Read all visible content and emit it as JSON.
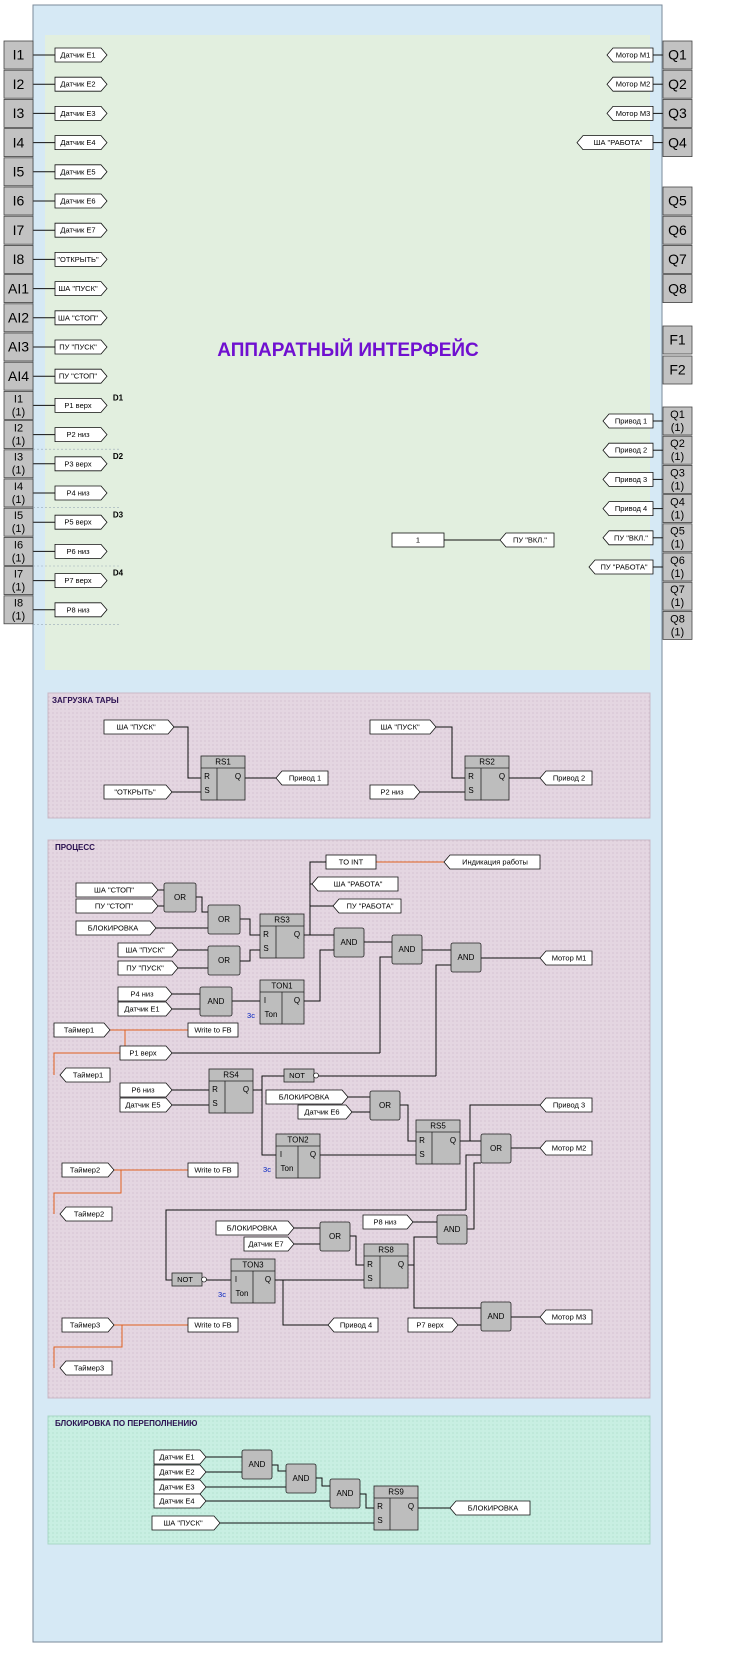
{
  "inputs_main": [
    "I1",
    "I2",
    "I3",
    "I4",
    "I5",
    "I6",
    "I7",
    "I8",
    "AI1",
    "AI2",
    "AI3",
    "AI4"
  ],
  "inputs_ext": [
    {
      "top": "I1",
      "bot": "(1)"
    },
    {
      "top": "I2",
      "bot": "(1)"
    },
    {
      "top": "I3",
      "bot": "(1)"
    },
    {
      "top": "I4",
      "bot": "(1)"
    },
    {
      "top": "I5",
      "bot": "(1)"
    },
    {
      "top": "I6",
      "bot": "(1)"
    },
    {
      "top": "I7",
      "bot": "(1)"
    },
    {
      "top": "I8",
      "bot": "(1)"
    }
  ],
  "input_tags": [
    "Датчик E1",
    "Датчик E2",
    "Датчик E3",
    "Датчик E4",
    "Датчик E5",
    "Датчик E6",
    "Датчик E7",
    "\"ОТКРЫТЬ\"",
    "ША \"ПУСК\"",
    "ША \"СТОП\"",
    "ПУ \"ПУСК\"",
    "ПУ \"СТОП\"",
    "P1 верх",
    "P2  низ",
    "P3 верх",
    "P4  низ",
    "P5 верх",
    "P6  низ",
    "P7 верх",
    "P8  низ"
  ],
  "d_labels": [
    "D1",
    "D2",
    "D3",
    "D4"
  ],
  "outputs_main": [
    "Q1",
    "Q2",
    "Q3",
    "Q4",
    "Q5",
    "Q6",
    "Q7",
    "Q8",
    "F1",
    "F2"
  ],
  "outputs_main_tags": [
    "Мотор M1",
    "Мотор M2",
    "Мотор M3",
    "ША \"РАБОТА\""
  ],
  "outputs_ext": [
    {
      "top": "Q1",
      "bot": "(1)"
    },
    {
      "top": "Q2",
      "bot": "(1)"
    },
    {
      "top": "Q3",
      "bot": "(1)"
    },
    {
      "top": "Q4",
      "bot": "(1)"
    },
    {
      "top": "Q5",
      "bot": "(1)"
    },
    {
      "top": "Q6",
      "bot": "(1)"
    },
    {
      "top": "Q7",
      "bot": "(1)"
    },
    {
      "top": "Q8",
      "bot": "(1)"
    }
  ],
  "outputs_ext_tags": [
    "Привод 1",
    "Привод 2",
    "Привод 3",
    "Привод 4",
    "ПУ \"ВКЛ.\"",
    "ПУ \"РАБОТА\""
  ],
  "hw_title": "АППАРАТНЫЙ ИНТЕРФЕЙС",
  "const_one": "1",
  "const_one_tag": "ПУ \"ВКЛ.\"",
  "sections": {
    "load": "ЗАГРУЗКА  ТАРЫ",
    "process": "ПРОЦЕСС",
    "block": "БЛОКИРОВКА   ПО    ПЕРЕПОЛНЕНИЮ"
  },
  "load": {
    "rs1": {
      "name": "RS1",
      "r": "R",
      "s": "S",
      "q": "Q"
    },
    "rs2": {
      "name": "RS2",
      "r": "R",
      "s": "S",
      "q": "Q"
    },
    "tags": [
      "ША \"ПУСК\"",
      "\"ОТКРЫТЬ\"",
      "Привод 1",
      "ША \"ПУСК\"",
      "P2  низ",
      "Привод 2"
    ]
  },
  "process": {
    "blocks": {
      "or": "OR",
      "and": "AND",
      "not": "NOT",
      "rs3": "RS3",
      "rs4": "RS4",
      "rs5": "RS5",
      "rs8": "RS8",
      "ton1": "TON1",
      "ton2": "TON2",
      "ton3": "TON3",
      "to_int": "TO INT",
      "ton_in": "Ton",
      "ton_i": "I",
      "q": "Q",
      "r": "R",
      "s": "S",
      "delay": "3с",
      "write_fb": "Write to FB"
    },
    "tags": {
      "indication": "Индикация работы",
      "sha_rabota": "ША \"РАБОТА\"",
      "pu_rabota": "ПУ \"РАБОТА\"",
      "sha_stop": "ША \"СТОП\"",
      "pu_stop": "ПУ \"СТОП\"",
      "blokirovka": "БЛОКИРОВКА",
      "sha_pusk": "ША \"ПУСК\"",
      "pu_pusk": "ПУ \"ПУСК\"",
      "p4": "P4 низ",
      "e1": "Датчик E1",
      "motor1": "Мотор M1",
      "timer1": "Таймер1",
      "p1": "P1 верх",
      "p6": "P6 низ",
      "e5": "Датчик E5",
      "e6": "Датчик E6",
      "privod3": "Привод 3",
      "motor2": "Мотор M2",
      "timer2": "Таймер2",
      "e7": "Датчик E7",
      "p8": "P8  низ",
      "privod4": "Привод 4",
      "p7": "P7 верх",
      "motor3": "Мотор M3",
      "timer3": "Таймер3"
    }
  },
  "block": {
    "tags": [
      "Датчик E1",
      "Датчик E2",
      "Датчик E3",
      "Датчик E4",
      "ША \"ПУСК\"",
      "БЛОКИРОВКА"
    ],
    "rs9": "RS9",
    "and": "AND"
  },
  "colors": {
    "frame": "#d6e9f5",
    "hw_area": "#e2efdf",
    "load_area": "#e6d9e3",
    "process_area": "#e6d9e3",
    "block_area": "#c7efe2",
    "title": "#7010d0",
    "wire_orange": "#e06020"
  }
}
